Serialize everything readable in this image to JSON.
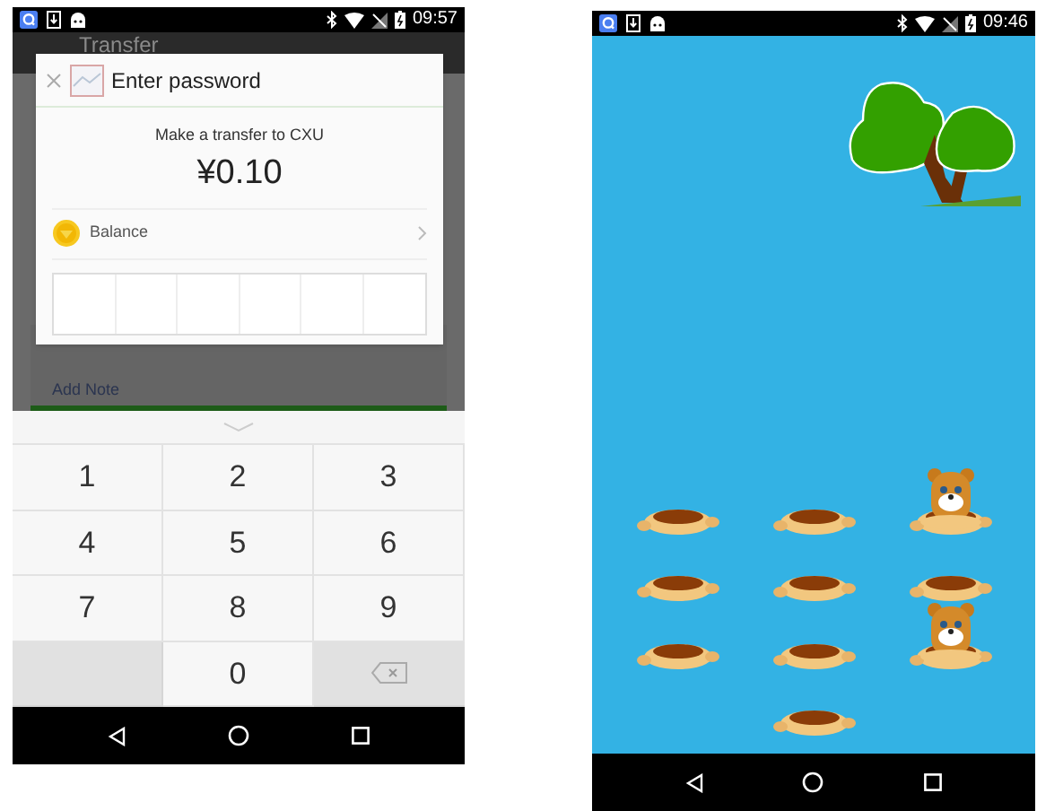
{
  "left_phone": {
    "status_bar": {
      "time": "09:57"
    },
    "app_bar": {
      "title": "Transfer"
    },
    "background": {
      "note_link": "Add Note"
    },
    "dialog": {
      "title": "Enter password",
      "subtitle": "Make a transfer to CXU",
      "amount": "¥0.10",
      "payment_method": "Balance"
    },
    "keypad": {
      "keys": [
        {
          "kind": "digit",
          "label": "1"
        },
        {
          "kind": "digit",
          "label": "2"
        },
        {
          "kind": "digit",
          "label": "3"
        },
        {
          "kind": "digit",
          "label": "4"
        },
        {
          "kind": "digit",
          "label": "5"
        },
        {
          "kind": "digit",
          "label": "6"
        },
        {
          "kind": "digit",
          "label": "7"
        },
        {
          "kind": "digit",
          "label": "8"
        },
        {
          "kind": "digit",
          "label": "9"
        },
        {
          "kind": "blank"
        },
        {
          "kind": "digit",
          "label": "0"
        },
        {
          "kind": "delete"
        }
      ]
    }
  },
  "right_phone": {
    "status_bar": {
      "time": "09:46"
    },
    "holes": [
      [
        {
          "kind": "hole"
        },
        {
          "kind": "hole"
        },
        {
          "kind": "mole"
        }
      ],
      [
        {
          "kind": "hole"
        },
        {
          "kind": "hole"
        },
        {
          "kind": "hole"
        }
      ],
      [
        {
          "kind": "hole"
        },
        {
          "kind": "hole"
        },
        {
          "kind": "mole"
        }
      ],
      [
        {
          "kind": "blank"
        },
        {
          "kind": "hole"
        },
        {
          "kind": "blank"
        }
      ]
    ]
  }
}
